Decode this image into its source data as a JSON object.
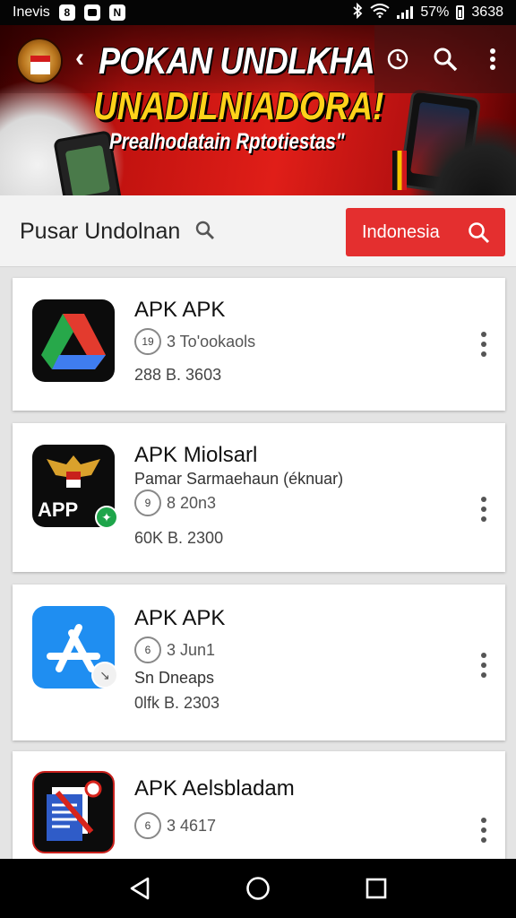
{
  "status_bar": {
    "carrier": "Inevis",
    "left_icons": [
      "8",
      "",
      "N"
    ],
    "battery_text": "57%",
    "time": "3638"
  },
  "banner": {
    "title": "POKAN UNDLKHA",
    "subtitle": "UNADILNIADORA!",
    "tagline": "Prealhodatain Rptotiestas\""
  },
  "search": {
    "label": "Pusar Undolnan",
    "region_button": "Indonesia"
  },
  "apps": [
    {
      "name": "APK  APK",
      "desc": "",
      "badge": "19",
      "meta": "3 To'ookaols",
      "size": "288 B. 3603",
      "icon": "drive-icon"
    },
    {
      "name": "APK Miolsarl",
      "desc": "Pamar Sarmaehaun (éknuar)",
      "badge": "9",
      "meta": "8 20n3",
      "size": "60K B. 2300",
      "icon": "garuda-app-icon",
      "icon_label": "APP"
    },
    {
      "name": "APK APK",
      "desc": "Sn Dneaps",
      "badge": "6",
      "meta": "3 Jun1",
      "size": "0lfk B. 2303",
      "icon": "app-store-icon"
    },
    {
      "name": "APK Aelsbladam",
      "desc": "",
      "badge": "6",
      "meta": "3 4617",
      "size": "",
      "icon": "document-icon"
    }
  ],
  "colors": {
    "accent": "#e42f2f",
    "banner_yellow": "#ffd21a"
  }
}
